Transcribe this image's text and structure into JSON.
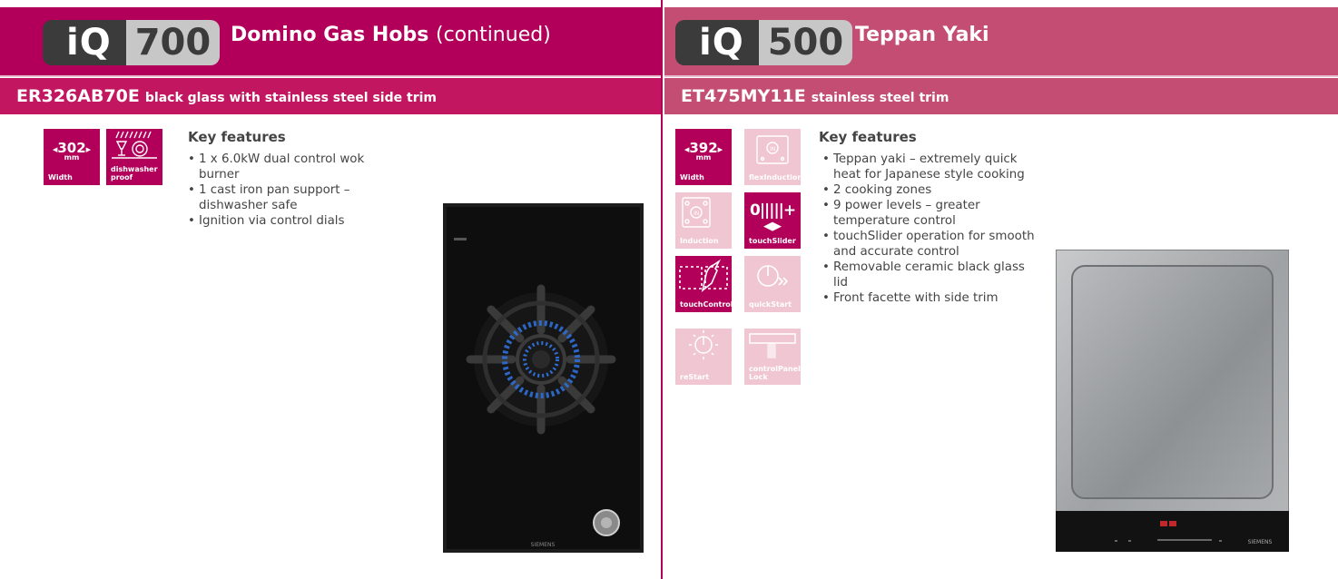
{
  "left": {
    "logo": {
      "iq": "iQ",
      "num": "700"
    },
    "title": "Domino Gas Hobs",
    "title_suffix": "(continued)",
    "model_code": "ER326AB70E",
    "model_desc": "black glass with stainless steel side trim",
    "icons": [
      {
        "name": "width-icon",
        "value": "302",
        "unit": "mm",
        "label": "Width"
      },
      {
        "name": "dishwasher-proof-icon",
        "label_line1": "dishwasher",
        "label_line2": "proof"
      }
    ],
    "features_title": "Key features",
    "features": [
      "1 x 6.0kW dual control wok burner",
      "1 cast iron pan support – dishwasher safe",
      "Ignition via control dials"
    ],
    "product_brand": "SIEMENS"
  },
  "right": {
    "logo": {
      "iq": "iQ",
      "num": "500"
    },
    "title": "Teppan Yaki",
    "model_code": "ET475MY11E",
    "model_desc": "stainless steel trim",
    "icons": [
      {
        "name": "width-icon",
        "value": "392",
        "unit": "mm",
        "label": "Width"
      },
      {
        "name": "flexinduction-icon",
        "label": "flexInduction"
      },
      {
        "name": "induction-icon",
        "label": "Induction"
      },
      {
        "name": "touchslider-icon",
        "label": "touchSlider"
      },
      {
        "name": "touchcontrol-icon",
        "label": "touchControl"
      },
      {
        "name": "quickstart-icon",
        "label": "quickStart"
      },
      {
        "name": "restart-icon",
        "label": "reStart"
      },
      {
        "name": "controlpanel-lock-icon",
        "label_line1": "controlPanel",
        "label_line2": "Lock"
      }
    ],
    "features_title": "Key features",
    "features": [
      "Teppan yaki – extremely quick heat for Japanese style cooking",
      "2 cooking zones",
      "9 power levels – greater temperature control",
      "touchSlider operation for smooth and accurate control",
      "Removable ceramic black glass lid",
      "Front facette with side trim"
    ],
    "product_brand": "SIEMENS"
  },
  "colors": {
    "left_header": "#b2005a",
    "left_model_bar": "#c21760",
    "right_header": "#c44d74",
    "right_model_bar": "#c44d74",
    "divider": "#b2005a",
    "tile_dark": "#b2005a",
    "tile_light": "#f0c6d2"
  }
}
